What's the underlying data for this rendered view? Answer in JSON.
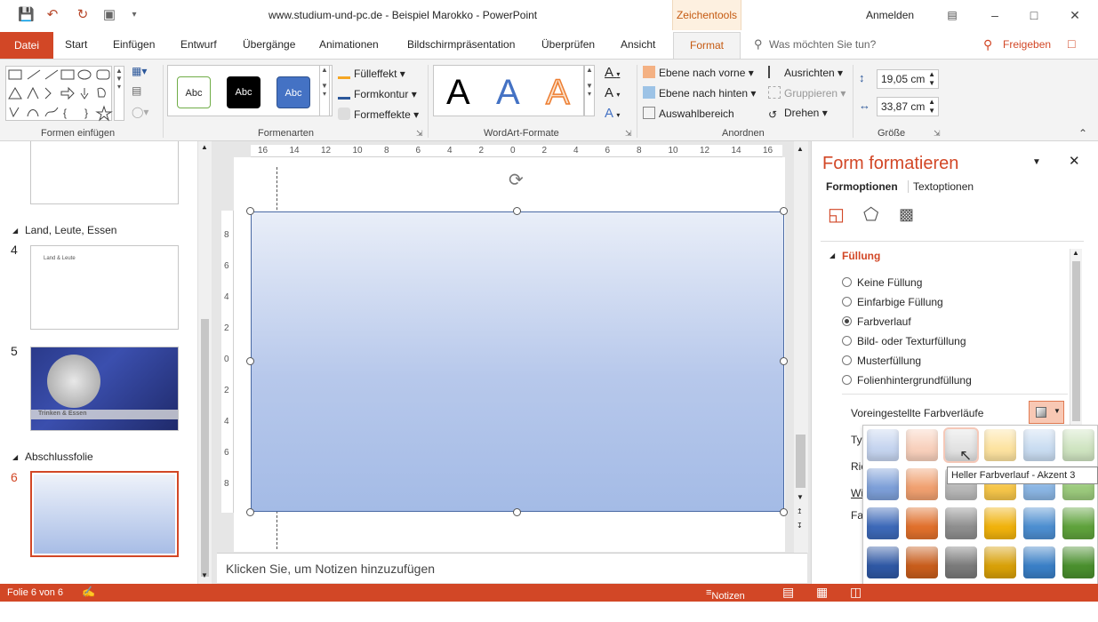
{
  "window": {
    "title": "www.studium-und-pc.de - Beispiel Marokko  -  PowerPoint",
    "context_tab": "Zeichentools",
    "signin": "Anmelden"
  },
  "tabs": [
    "Datei",
    "Start",
    "Einfügen",
    "Entwurf",
    "Übergänge",
    "Animationen",
    "Bildschirmpräsentation",
    "Überprüfen",
    "Ansicht",
    "Format"
  ],
  "search_placeholder": "Was möchten Sie tun?",
  "share_label": "Freigeben",
  "ribbon": {
    "groups": {
      "shapes": "Formen einfügen",
      "styles": "Formenarten",
      "wordart": "WordArt-Formate",
      "arrange": "Anordnen",
      "size": "Größe"
    },
    "style_abc": [
      "Abc",
      "Abc",
      "Abc"
    ],
    "fill": "Fülleffekt",
    "outline": "Formkontur",
    "effects": "Formeffekte",
    "wordart_letter": "A",
    "arrange_items": {
      "forward": "Ebene nach vorne",
      "backward": "Ebene nach hinten",
      "selection": "Auswahlbereich",
      "align": "Ausrichten",
      "group": "Gruppieren",
      "rotate": "Drehen"
    },
    "height": "19,05  cm",
    "width": "33,87  cm"
  },
  "slides": {
    "sections": [
      "Land, Leute, Essen",
      "Abschlussfolie"
    ],
    "numbers": [
      "4",
      "5",
      "6"
    ],
    "thumb4_title": "Land & Leute",
    "thumb5_caption": "Trinken & Essen"
  },
  "rulers": {
    "h_ticks": [
      "16",
      "14",
      "12",
      "10",
      "8",
      "6",
      "4",
      "2",
      "0",
      "2",
      "4",
      "6",
      "8",
      "10",
      "12",
      "14",
      "16"
    ],
    "v_ticks": [
      "8",
      "6",
      "4",
      "2",
      "0",
      "2",
      "4",
      "6",
      "8"
    ]
  },
  "notes_placeholder": "Klicken Sie, um Notizen hinzuzufügen",
  "pane": {
    "title": "Form formatieren",
    "tab_shape": "Formoptionen",
    "tab_text": "Textoptionen",
    "section": "Füllung",
    "options": [
      "Keine Füllung",
      "Einfarbige Füllung",
      "Farbverlauf",
      "Bild- oder Texturfüllung",
      "Musterfüllung",
      "Folienhintergrundfüllung"
    ],
    "selected_option": "Farbverlauf",
    "preset_label": "Voreingestellte Farbverläufe",
    "partial_labels": [
      "Ty",
      "Ric",
      "Wi",
      "Fa"
    ]
  },
  "tooltip": "Heller Farbverlauf - Akzent 3",
  "gallery_colors": [
    [
      "#c5d4ef",
      "#f8d0bc",
      "#e2e2e2",
      "#fde3a0",
      "#c9dcf1",
      "#cfe4c1"
    ],
    [
      "#7d9fd8",
      "#f0a070",
      "#b8b8b8",
      "#f6c64a",
      "#8bb6e4",
      "#9ccb7d"
    ],
    [
      "#3d69b8",
      "#e0702c",
      "#8e8e8e",
      "#f0b20c",
      "#4d8ed0",
      "#5fa23c"
    ],
    [
      "#2f58a4",
      "#c85d1c",
      "#7a7a7a",
      "#d8a008",
      "#3a7fc6",
      "#4a8f2e"
    ],
    [
      "#2a4f96",
      "#d05a14",
      "#6e6e6e",
      "#d49e06",
      "#3377c2",
      "#448a2a"
    ]
  ],
  "status": {
    "slide_info": "Folie 6 von 6",
    "notes": "Notizen"
  }
}
